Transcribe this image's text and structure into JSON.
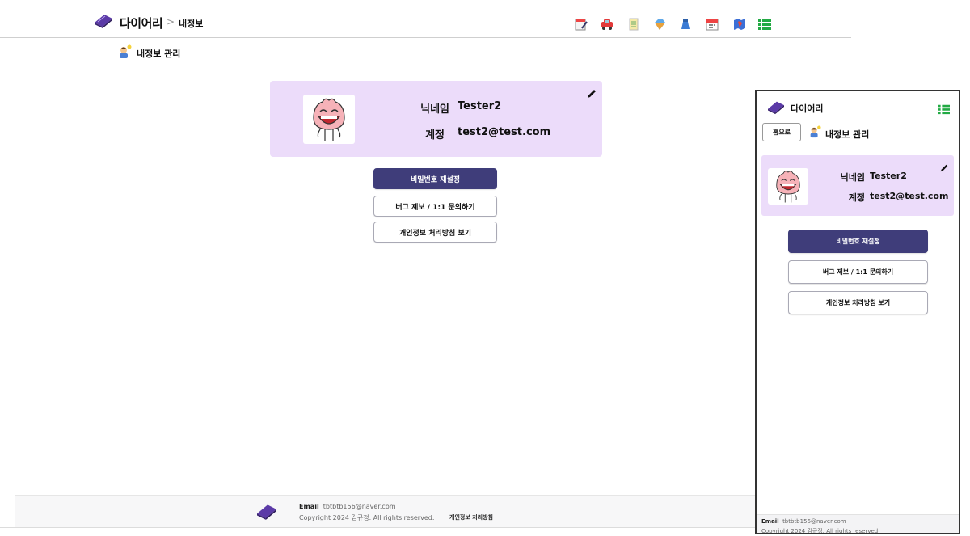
{
  "header": {
    "brand": "다이어리",
    "breadcrumb_sep": ">",
    "breadcrumb": "내정보",
    "toolbar_icons": [
      "diary-icon",
      "car-icon",
      "checklist-icon",
      "gem-icon",
      "money-icon",
      "calendar-icon",
      "map-icon",
      "menu-list-icon"
    ]
  },
  "subheader": {
    "title": "내정보 관리"
  },
  "profile": {
    "nickname_label": "닉네임",
    "nickname": "Tester2",
    "account_label": "계정",
    "account": "test2@test.com"
  },
  "actions": {
    "reset_password": "비밀번호 재설정",
    "bug_report": "버그 제보 / 1:1 문의하기",
    "privacy_policy": "개인정보 처리방침 보기"
  },
  "footer": {
    "email_label": "Email",
    "email": "tbtbtb156@naver.com",
    "copyright": "Copyright 2024 김규정. All rights reserved.",
    "policy_link": "개인정보 처리방침"
  },
  "mobile": {
    "brand": "다이어리",
    "home_button": "홈으로",
    "title": "내정보 관리"
  },
  "colors": {
    "card_bg": "#ecdcfa",
    "primary_button": "#3f3d7a",
    "menu_icon": "#22aa44"
  }
}
